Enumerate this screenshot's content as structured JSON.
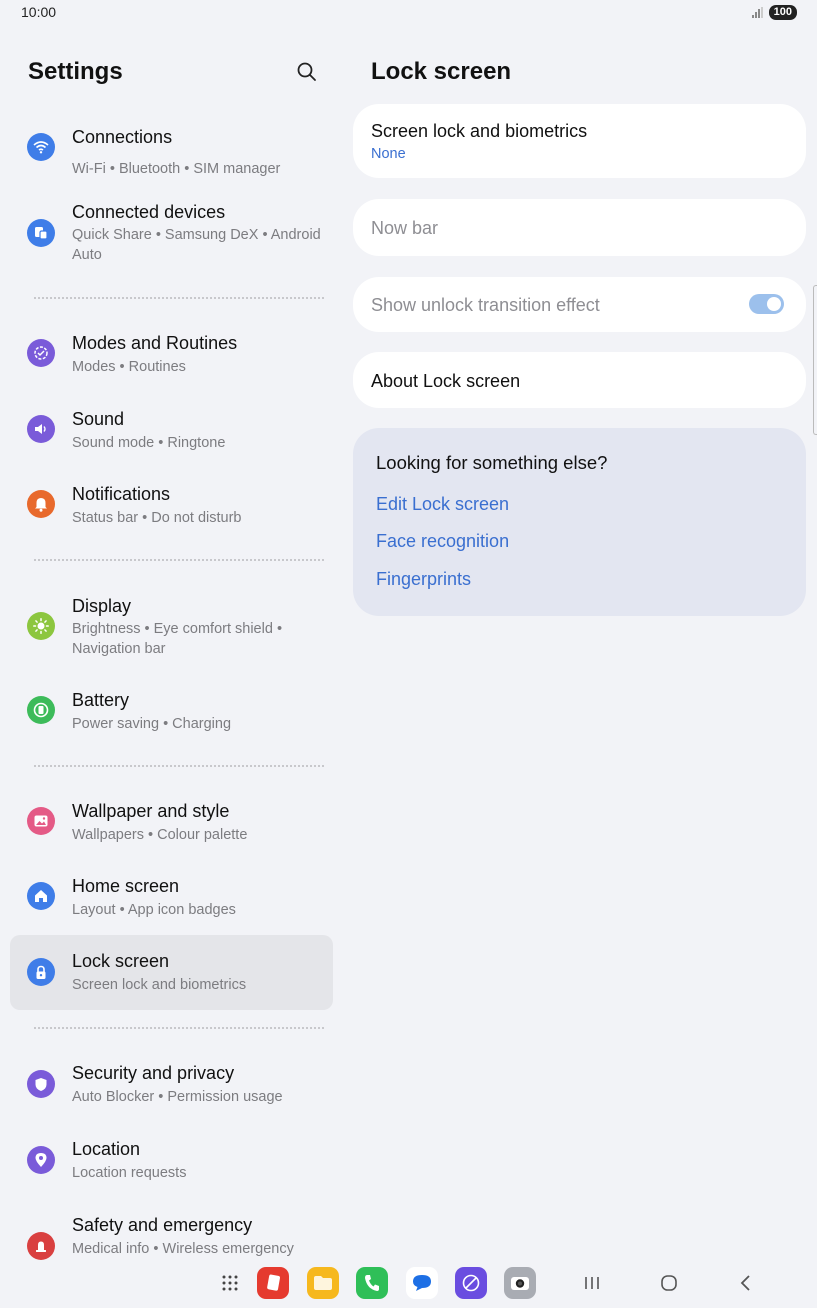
{
  "status_bar": {
    "time": "10:00",
    "battery": "100"
  },
  "left": {
    "title": "Settings",
    "items": [
      {
        "title": "Connections",
        "subtitle": "Wi-Fi  •  Bluetooth  •  SIM manager",
        "icon": "wifi-icon",
        "color": "#3f7de8"
      },
      {
        "title": "Connected devices",
        "subtitle": "Quick Share  •  Samsung DeX  •  Android Auto",
        "icon": "devices-icon",
        "color": "#3f7de8"
      },
      {
        "title": "Modes and Routines",
        "subtitle": "Modes  •  Routines",
        "icon": "routine-icon",
        "color": "#7a5bd9"
      },
      {
        "title": "Sound",
        "subtitle": "Sound mode  •  Ringtone",
        "icon": "speaker-icon",
        "color": "#7a5bd9"
      },
      {
        "title": "Notifications",
        "subtitle": "Status bar  •  Do not disturb",
        "icon": "bell-icon",
        "color": "#e8692c"
      },
      {
        "title": "Display",
        "subtitle": "Brightness  •  Eye comfort shield  •  Navigation bar",
        "icon": "sun-icon",
        "color": "#8cc63f"
      },
      {
        "title": "Battery",
        "subtitle": "Power saving  •  Charging",
        "icon": "battery-icon",
        "color": "#3dbb5a"
      },
      {
        "title": "Wallpaper and style",
        "subtitle": "Wallpapers  •  Colour palette",
        "icon": "image-icon",
        "color": "#e45a86"
      },
      {
        "title": "Home screen",
        "subtitle": "Layout  •  App icon badges",
        "icon": "home-icon",
        "color": "#3f7de8"
      },
      {
        "title": "Lock screen",
        "subtitle": "Screen lock and biometrics",
        "icon": "lock-icon",
        "color": "#3f7de8"
      },
      {
        "title": "Security and privacy",
        "subtitle": "Auto Blocker  •  Permission usage",
        "icon": "shield-icon",
        "color": "#7a5bd9"
      },
      {
        "title": "Location",
        "subtitle": "Location requests",
        "icon": "location-pin-icon",
        "color": "#7a5bd9"
      },
      {
        "title": "Safety and emergency",
        "subtitle": "Medical info  •  Wireless emergency",
        "icon": "emergency-icon",
        "color": "#d94040"
      }
    ]
  },
  "right": {
    "title": "Lock screen",
    "screen_lock": {
      "title": "Screen lock and biometrics",
      "value": "None"
    },
    "now_bar": "Now bar",
    "unlock_effect": {
      "title": "Show unlock transition effect",
      "on": true
    },
    "about": "About Lock screen",
    "suggest": {
      "heading": "Looking for something else?",
      "links": [
        "Edit Lock screen",
        "Face recognition",
        "Fingerprints"
      ]
    }
  },
  "dock": {
    "apps": [
      "apps-grid-icon",
      "notes-app-icon",
      "files-app-icon",
      "phone-app-icon",
      "messages-app-icon",
      "browser-app-icon",
      "camera-app-icon"
    ],
    "nav": [
      "recents-icon",
      "home-nav-icon",
      "back-icon"
    ]
  }
}
